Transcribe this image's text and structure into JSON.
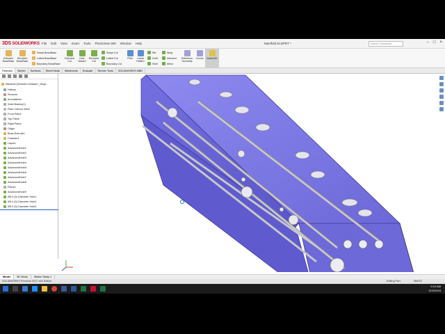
{
  "app": {
    "logo": "SOLIDWORKS",
    "menu": [
      "File",
      "Edit",
      "View",
      "Insert",
      "Tools",
      "PhotoView 360",
      "Window",
      "Help"
    ],
    "document_title": "Manifold.SLDPRT *",
    "search_placeholder": "Search Commands"
  },
  "commands": {
    "extruded_boss": "Extruded Boss/Base",
    "revolved_boss": "Revolved Boss/Base",
    "swept_boss": "Swept Boss/Base",
    "lofted_boss": "Lofted Boss/Base",
    "boundary_boss": "Boundary Boss/Base",
    "extruded_cut": "Extruded Cut",
    "hole_wizard": "Hole Wizard",
    "revolved_cut": "Revolved Cut",
    "swept_cut": "Swept Cut",
    "lofted_cut": "Lofted Cut",
    "boundary_cut": "Boundary Cut",
    "fillet": "Fillet",
    "linear_pattern": "Linear Pattern",
    "rib": "Rib",
    "draft": "Draft",
    "shell": "Shell",
    "wrap": "Wrap",
    "intersect": "Intersect",
    "mirror": "Mirror",
    "reference_geometry": "Reference Geometry",
    "curves": "Curves",
    "instant3d": "Instant3D"
  },
  "tabs": [
    "Features",
    "Sketch",
    "Surfaces",
    "Sheet Metal",
    "Weldments",
    "Evaluate",
    "Render Tools",
    "SOLIDWORKS MBD"
  ],
  "tree": {
    "root": "Manifold (Default<<Default>_Displ...",
    "items": [
      "History",
      "Sensors",
      "Annotations",
      "Solid Bodies(1)",
      "Plain Carbon Steel",
      "Front Plane",
      "Top Plane",
      "Right Plane",
      "Origin",
      "Boss-Extrude1",
      "Chamfer1",
      "Layout",
      "AdvancedHole1",
      "AdvancedHole2",
      "AdvancedHole3",
      "AdvancedHole4",
      "AdvancedHole5",
      "AdvancedHole6",
      "AdvancedHole7",
      "AdvancedHole8",
      "Plane1",
      "AdvancedHole9",
      "Ø5.0 (5) Diameter Hole1",
      "Ø5.0 (5) Diameter Hole2",
      "Ø5.0 (5) Diameter Hole3"
    ]
  },
  "bottom_tabs": [
    "Model",
    "3D Views",
    "Motion Study 1"
  ],
  "status": {
    "left": "SOLIDWORKS Premium 2017 x64 Edition",
    "mode": "Editing Part",
    "units": "MMGS"
  },
  "clock": {
    "time": "9:10 AM",
    "date": "12/2/2016"
  },
  "colors": {
    "body_fill": "#7b77e0",
    "body_edge": "#3f3c9e",
    "accent_red": "#c8102e",
    "taskbar": "#1b1b1b"
  }
}
